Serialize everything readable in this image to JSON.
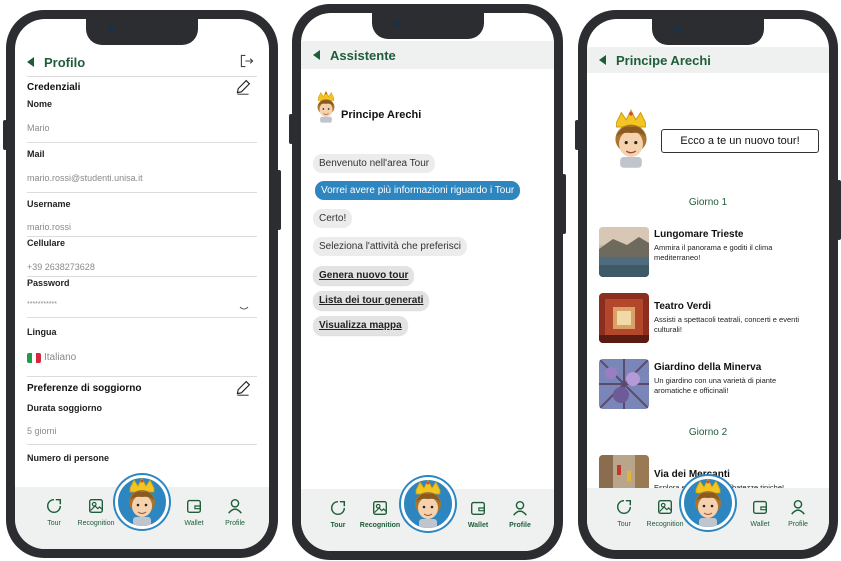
{
  "profile": {
    "title": "Profilo",
    "credentials_title": "Credenziali",
    "fields": [
      {
        "label": "Nome",
        "value": "Mario"
      },
      {
        "label": "Mail",
        "value": "mario.rossi@studenti.unisa.it"
      },
      {
        "label": "Username",
        "value": "mario.rossi"
      },
      {
        "label": "Cellulare",
        "value": "+39 2638273628"
      },
      {
        "label": "Password",
        "value": "***********"
      }
    ],
    "language_label": "Lingua",
    "language_value": "Italiano",
    "stay_title": "Preferenze di soggiorno",
    "stay_fields": [
      {
        "label": "Durata soggiorno",
        "value": "5 giorni"
      },
      {
        "label": "Numero di persone",
        "value": ""
      }
    ]
  },
  "assistant": {
    "title": "Assistente",
    "bot_name": "Principe Arechi",
    "messages": [
      {
        "from": "bot",
        "text": "Benvenuto nell'area Tour"
      },
      {
        "from": "user",
        "text": "Vorrei avere più informazioni riguardo i Tour"
      },
      {
        "from": "bot",
        "text": "Certo!"
      },
      {
        "from": "bot",
        "text": "Seleziona l'attività che preferisci"
      }
    ],
    "options": [
      "Genera nuovo tour",
      "Lista dei tour generati",
      "Visualizza mappa"
    ]
  },
  "tour": {
    "title": "Principe Arechi",
    "speech": "Ecco a te un nuovo tour!",
    "days": [
      "Giorno 1",
      "Giorno 2"
    ],
    "items": [
      {
        "name": "Lungomare Trieste",
        "desc": "Ammira il panorama e goditi il clima mediterraneo!"
      },
      {
        "name": "Teatro Verdi",
        "desc": "Assisti a spettacoli teatrali, concerti e eventi culturali!"
      },
      {
        "name": "Giardino della Minerva",
        "desc": "Un giardino con una varietà di piante aromatiche e officinali!"
      },
      {
        "name": "Via dei Mercanti",
        "desc": "Esplora e acquista prelibatezze tipiche!"
      }
    ]
  },
  "nav": {
    "tour": "Tour",
    "recognition": "Recognition",
    "wallet": "Wallet",
    "profile": "Profile"
  },
  "colors": {
    "accent_green": "#1f5d3a",
    "accent_blue": "#2e86c1",
    "nav_bg": "#eef1ef",
    "phone_frame": "#2b2d30"
  }
}
